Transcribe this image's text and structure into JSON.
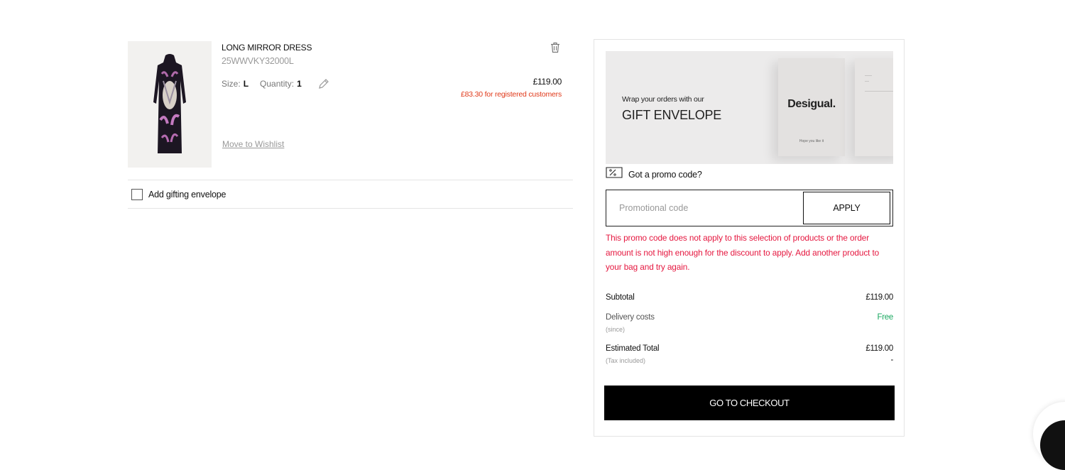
{
  "item": {
    "name": "LONG MIRROR DRESS",
    "reference": "25WWVKY32000L",
    "size_label": "Size:",
    "size_value": "L",
    "quantity_label": "Quantity:",
    "quantity_value": "1",
    "price": "£119.00",
    "registered_price": "£83.30 for registered customers",
    "move_to_wishlist": "Move to Wishlist"
  },
  "gifting": {
    "checkbox_label": "Add gifting envelope",
    "checked": false
  },
  "banner": {
    "small_text": "Wrap your orders with our",
    "big_text": "GIFT ENVELOPE",
    "brand": "Desigual.",
    "envelope_tagline": "Hope you like it"
  },
  "promo": {
    "toggle_label": "Got a promo code?",
    "placeholder": "Promotional code",
    "value": "",
    "apply_label": "APPLY",
    "error": "This promo code does not apply to this selection of products or the order amount is not high enough for the discount to apply. Add another product to your bag and try again."
  },
  "summary": {
    "subtotal_label": "Subtotal",
    "subtotal_value": "£119.00",
    "delivery_label": "Delivery costs",
    "delivery_sub": "(since)",
    "delivery_value": "Free",
    "total_label": "Estimated Total",
    "total_sub": "(Tax included)",
    "total_value": "£119.00",
    "total_extra": "-",
    "checkout_label": "GO TO CHECKOUT"
  },
  "colors": {
    "accent": "#000000",
    "error": "#e5173f",
    "discount": "#e0391a",
    "free": "#1aa860"
  }
}
